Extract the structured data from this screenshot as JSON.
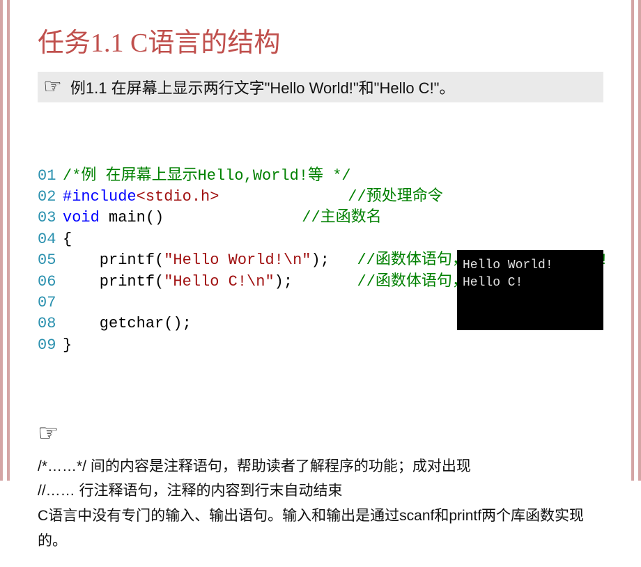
{
  "title": "任务1.1 C语言的结构",
  "example_label": "例1.1 在屏幕上显示两行文字\"Hello World!\"和\"Hello C!\"。",
  "code": {
    "lines": [
      {
        "num": "01",
        "parts": [
          {
            "cls": "cm-green",
            "t": "/*例 在屏幕上显示Hello,World!等 */"
          }
        ]
      },
      {
        "num": "02",
        "parts": [
          {
            "cls": "cm-blue",
            "t": "#include"
          },
          {
            "cls": "cm-red",
            "t": "<stdio.h>"
          },
          {
            "cls": "cm-black",
            "t": "              "
          },
          {
            "cls": "cm-green",
            "t": "//预处理命令"
          }
        ]
      },
      {
        "num": "03",
        "parts": [
          {
            "cls": "cm-blue",
            "t": "void"
          },
          {
            "cls": "cm-black",
            "t": " main()               "
          },
          {
            "cls": "cm-green",
            "t": "//主函数名"
          }
        ]
      },
      {
        "num": "04",
        "parts": [
          {
            "cls": "cm-black",
            "t": "{"
          }
        ]
      },
      {
        "num": "05",
        "parts": [
          {
            "cls": "cm-black",
            "t": "    printf("
          },
          {
            "cls": "cm-red",
            "t": "\"Hello World!\\n\""
          },
          {
            "cls": "cm-black",
            "t": ");   "
          },
          {
            "cls": "cm-green",
            "t": "//函数体语句，打印Hello World!"
          }
        ]
      },
      {
        "num": "06",
        "parts": [
          {
            "cls": "cm-black",
            "t": "    printf("
          },
          {
            "cls": "cm-red",
            "t": "\"Hello C!\\n\""
          },
          {
            "cls": "cm-black",
            "t": ");       "
          },
          {
            "cls": "cm-green",
            "t": "//函数体语句，打印Hello C!"
          }
        ]
      },
      {
        "num": "07",
        "parts": []
      },
      {
        "num": "08",
        "parts": [
          {
            "cls": "cm-black",
            "t": "    getchar();"
          }
        ]
      },
      {
        "num": "09",
        "parts": [
          {
            "cls": "cm-black",
            "t": "}"
          }
        ]
      }
    ]
  },
  "output": "Hello World!\nHello C!",
  "notes": [
    "/*……*/  间的内容是注释语句，帮助读者了解程序的功能；成对出现",
    "//……    行注释语句，注释的内容到行末自动结束",
    "C语言中没有专门的输入、输出语句。输入和输出是通过scanf和printf两个库函数实现的。"
  ],
  "pointer_glyph": "☞"
}
